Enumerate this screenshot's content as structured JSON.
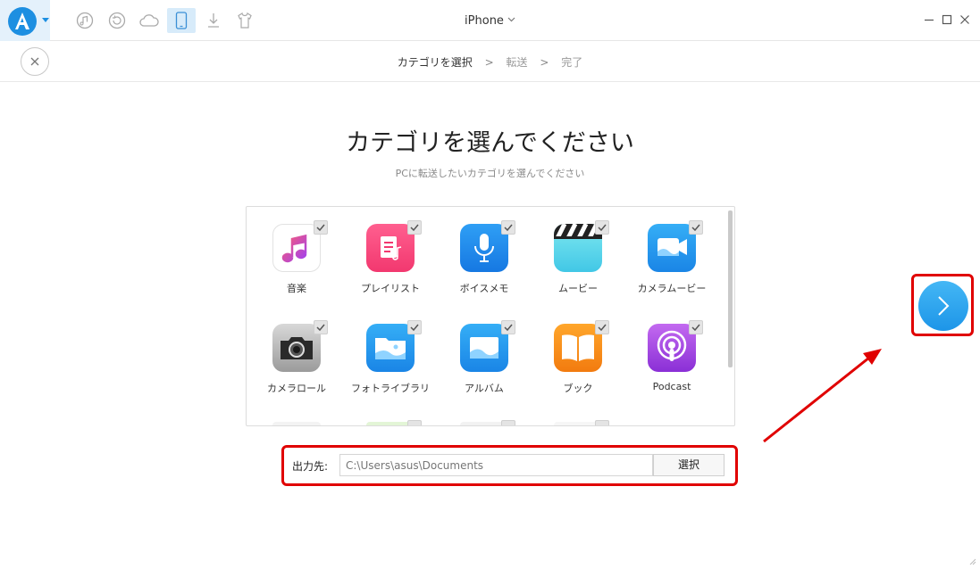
{
  "window": {
    "device_title": "iPhone"
  },
  "steps": {
    "current": "カテゴリを選択",
    "transfer": "転送",
    "done": "完了",
    "separator": ">"
  },
  "main": {
    "title": "カテゴリを選んでください",
    "subtitle": "PCに転送したいカテゴリを選んでください"
  },
  "categories": [
    {
      "label": "音楽",
      "icon": "music-icon",
      "checked": true
    },
    {
      "label": "プレイリスト",
      "icon": "playlist-icon",
      "checked": true
    },
    {
      "label": "ボイスメモ",
      "icon": "voice-memo-icon",
      "checked": true
    },
    {
      "label": "ムービー",
      "icon": "movie-icon",
      "checked": true
    },
    {
      "label": "カメラムービー",
      "icon": "camera-movie-icon",
      "checked": true
    },
    {
      "label": "カメラロール",
      "icon": "camera-icon",
      "checked": true
    },
    {
      "label": "フォトライブラリ",
      "icon": "photo-library-icon",
      "checked": true
    },
    {
      "label": "アルバム",
      "icon": "album-icon",
      "checked": true
    },
    {
      "label": "ブック",
      "icon": "book-icon",
      "checked": true
    },
    {
      "label": "Podcast",
      "icon": "podcast-icon",
      "checked": true
    }
  ],
  "output": {
    "label": "出力先:",
    "path": "C:\\Users\\asus\\Documents",
    "select_button": "選択"
  },
  "colors": {
    "accent": "#1d8fe1",
    "highlight": "#e00000"
  }
}
